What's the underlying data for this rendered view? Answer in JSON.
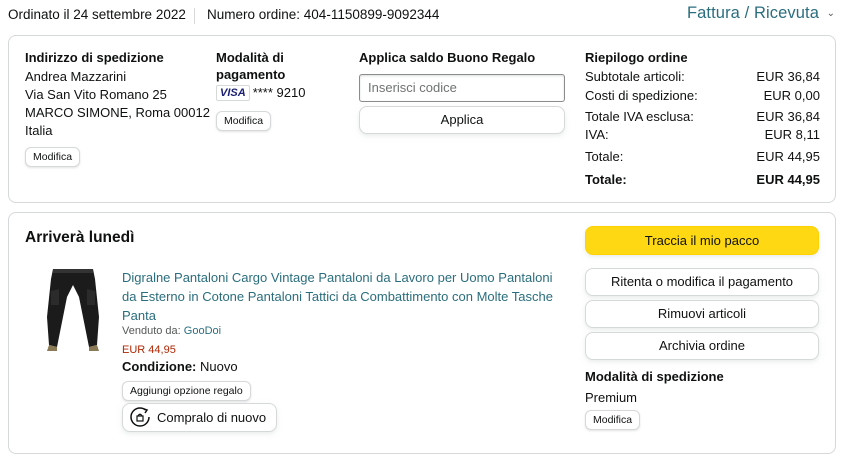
{
  "header": {
    "ordered": "Ordinato il 24 settembre 2022",
    "order_number": "Numero ordine: 404-1150899-9092344",
    "invoice": "Fattura / Ricevuta",
    "invoice_caret_icon": "chevron-down-icon"
  },
  "shipping_address": {
    "title": "Indirizzo di spedizione",
    "lines": [
      "Andrea Mazzarini",
      "Via San Vito Romano 25",
      "MARCO SIMONE, Roma 00012",
      "Italia"
    ],
    "edit": "Modifica"
  },
  "payment": {
    "title_1": "Modalità di",
    "title_2": "pagamento",
    "card_brand": "VISA",
    "card_number": "**** 9210",
    "edit": "Modifica"
  },
  "gift_card": {
    "title": "Applica saldo Buono Regalo",
    "placeholder": "Inserisci codice",
    "apply": "Applica"
  },
  "summary": {
    "title": "Riepilogo ordine",
    "rows": [
      {
        "label": "Subtotale articoli:",
        "value": "EUR 36,84"
      },
      {
        "label": "Costi di spedizione:",
        "value": "EUR 0,00"
      },
      {
        "label": "Totale IVA esclusa:",
        "value": "EUR 36,84"
      },
      {
        "label": "IVA:",
        "value": "EUR 8,11"
      },
      {
        "label": "Totale:",
        "value": "EUR 44,95"
      },
      {
        "label": "Totale:",
        "value": "EUR 44,95"
      }
    ]
  },
  "shipment": {
    "title": "Arriverà lunedì",
    "product_title": "Digralne Pantaloni Cargo Vintage Pantaloni da Lavoro per Uomo Pantaloni da Esterno in Cotone Pantaloni Tattici da Combattimento con Molte Tasche Panta",
    "sold_by_label": "Venduto da:",
    "seller": "GooDoi",
    "price": "EUR 44,95",
    "condition_label": "Condizione:",
    "condition_value": "Nuovo",
    "gift_option": "Aggiungi opzione regalo",
    "buy_again": "Compralo di nuovo",
    "buy_again_icon": "reorder-icon"
  },
  "actions": {
    "track": "Traccia il mio pacco",
    "retry_payment": "Ritenta o modifica il pagamento",
    "remove_items": "Rimuovi articoli",
    "archive": "Archivia ordine"
  },
  "shipping_method": {
    "title": "Modalità di spedizione",
    "value": "Premium",
    "edit": "Modifica"
  },
  "colors": {
    "link": "#2a6d7e",
    "price": "#b12704",
    "primary_button": "#ffd814",
    "border": "#d5d9d9"
  }
}
